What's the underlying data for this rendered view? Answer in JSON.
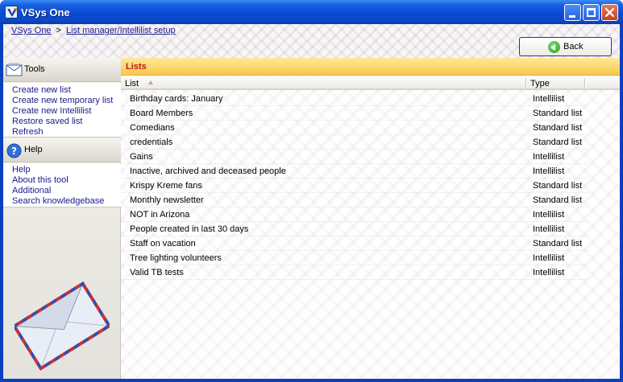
{
  "window": {
    "title": "VSys One",
    "controls": [
      "minimize-icon",
      "maximize-icon",
      "close-icon"
    ]
  },
  "breadcrumb": {
    "home": "VSys One",
    "separator": ">",
    "current": "List manager/Intellilist setup"
  },
  "back_button": {
    "label": "Back",
    "icon": "back-arrow-icon"
  },
  "sidebar": {
    "tools": {
      "title": "Tools",
      "icon": "envelope-icon",
      "links": [
        "Create new list",
        "Create new temporary list",
        "Create new Intellilist",
        "Restore saved list",
        "Refresh"
      ]
    },
    "help": {
      "title": "Help",
      "icon": "help-icon",
      "links": [
        "Help",
        "About this tool",
        "Additional",
        "Search knowledgebase"
      ]
    }
  },
  "lists": {
    "title": "Lists",
    "columns": {
      "name": "List",
      "type": "Type"
    },
    "sort": {
      "column": "List",
      "direction": "ascending"
    },
    "rows": [
      {
        "name": "Birthday cards: January",
        "type": "Intellilist"
      },
      {
        "name": "Board Members",
        "type": "Standard list"
      },
      {
        "name": "Comedians",
        "type": "Standard list"
      },
      {
        "name": "credentials",
        "type": "Standard list"
      },
      {
        "name": "Gains",
        "type": "Intellilist"
      },
      {
        "name": "Inactive, archived and deceased people",
        "type": "Intellilist"
      },
      {
        "name": "Krispy Kreme fans",
        "type": "Standard list"
      },
      {
        "name": "Monthly newsletter",
        "type": "Standard list"
      },
      {
        "name": "NOT in Arizona",
        "type": "Intellilist"
      },
      {
        "name": "People created in last 30 days",
        "type": "Intellilist"
      },
      {
        "name": "Staff on vacation",
        "type": "Standard list"
      },
      {
        "name": "Tree lighting volunteers",
        "type": "Intellilist"
      },
      {
        "name": "Valid TB tests",
        "type": "Intellilist"
      }
    ]
  },
  "colors": {
    "title_bar": "#0a4bd6",
    "section_header": "#f7c84a",
    "section_title": "#c01818",
    "link": "#1a1a8a"
  }
}
